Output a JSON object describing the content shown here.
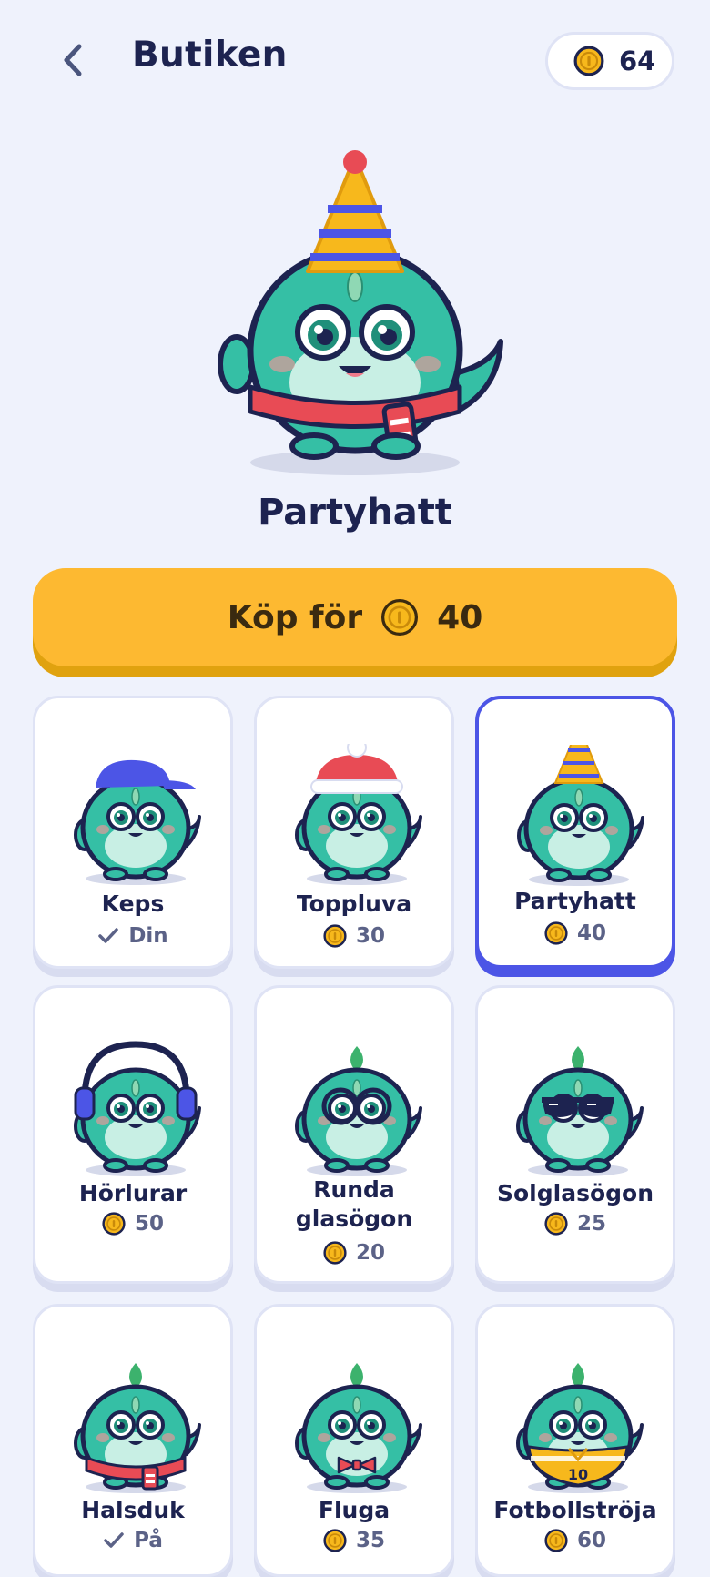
{
  "header": {
    "title": "Butiken",
    "coins": "64"
  },
  "preview": {
    "name": "Partyhatt"
  },
  "buy": {
    "label": "Köp för",
    "price": "40"
  },
  "items": [
    {
      "name": "Keps",
      "status": "Din",
      "owned": true
    },
    {
      "name": "Toppluva",
      "price": "30"
    },
    {
      "name": "Partyhatt",
      "price": "40",
      "selected": true
    },
    {
      "name": "Hörlurar",
      "price": "50"
    },
    {
      "name": "Runda glasögon",
      "price": "20"
    },
    {
      "name": "Solglasögon",
      "price": "25"
    },
    {
      "name": "Halsduk",
      "status": "På",
      "owned": true
    },
    {
      "name": "Fluga",
      "price": "35"
    },
    {
      "name": "Fotbollströja",
      "price": "60",
      "jersey_number": "10"
    }
  ],
  "colors": {
    "accent": "#4c55e6",
    "buy": "#fdb931",
    "coin": "#f7b81c",
    "monster": "#35bfa5",
    "text": "#1d2350"
  },
  "icons": {
    "back": "chevron-left-icon",
    "coin": "coin-icon",
    "check": "check-icon"
  }
}
